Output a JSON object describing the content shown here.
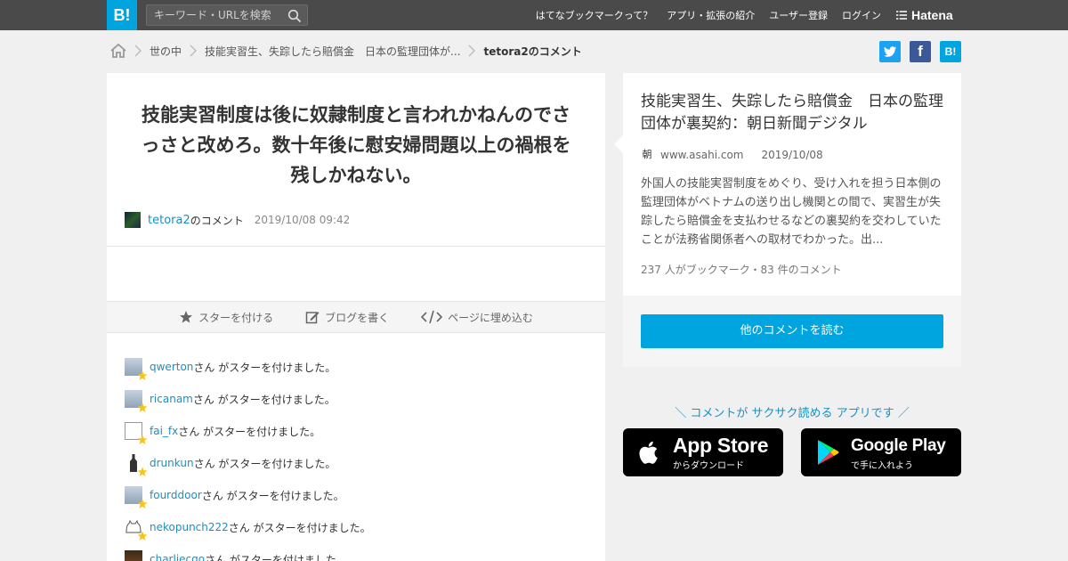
{
  "header": {
    "logo": "B!",
    "search_placeholder": "キーワード・URLを検索",
    "nav": [
      "はてなブックマークって？",
      "アプリ・拡張の紹介",
      "ユーザー登録",
      "ログイン"
    ],
    "hatena_label": "Hatena"
  },
  "breadcrumb": {
    "items": [
      "世の中",
      "技能実習生、失踪したら賠償金　日本の監理団体が...",
      "tetora2のコメント"
    ]
  },
  "share": {
    "twitter": "",
    "facebook": "f",
    "hatena": "B!"
  },
  "comment": {
    "text": "技能実習制度は後に奴隷制度と言われかねんのでさっさと改めろ。数十年後に慰安婦問題以上の禍根を残しかねない。",
    "user": "tetora2",
    "suffix": "のコメント",
    "datetime": "2019/10/08 09:42"
  },
  "actions": {
    "star": "スターを付ける",
    "blog": "ブログを書く",
    "embed": "ページに埋め込む"
  },
  "stars": {
    "suffix": "さん がスターを付けました。",
    "items": [
      {
        "name": "qwerton"
      },
      {
        "name": "ricanam"
      },
      {
        "name": "fai_fx"
      },
      {
        "name": "drunkun"
      },
      {
        "name": "fourddoor"
      },
      {
        "name": "nekopunch222"
      },
      {
        "name": "charliecgo"
      }
    ]
  },
  "entry": {
    "title": "技能実習生、失踪したら賠償金　日本の監理団体が裏契約：朝日新聞デジタル",
    "favicon": "朝",
    "domain": "www.asahi.com",
    "date": "2019/10/08",
    "description": "外国人の技能実習制度をめぐり、受け入れを担う日本側の監理団体がベトナムの送り出し機関との間で、実習生が失踪したら賠償金を支払わせるなどの裏契約を交わしていたことが法務省関係者への取材でわかった。出...",
    "counts": "237 人がブックマーク・83 件のコメント",
    "read_button": "他のコメントを読む"
  },
  "apps": {
    "promo": "＼ コメントが サクサク読める アプリです ／",
    "appstore_main": "App Store",
    "appstore_sub": "からダウンロード",
    "googleplay_main": "Google Play",
    "googleplay_sub": "で手に入れよう"
  },
  "colors": {
    "brand": "#00a4de",
    "topbar": "#4a4a4a",
    "link": "#1a8fc4",
    "twitter": "#1da1f2",
    "facebook": "#3b5998",
    "star": "#f5c518"
  }
}
